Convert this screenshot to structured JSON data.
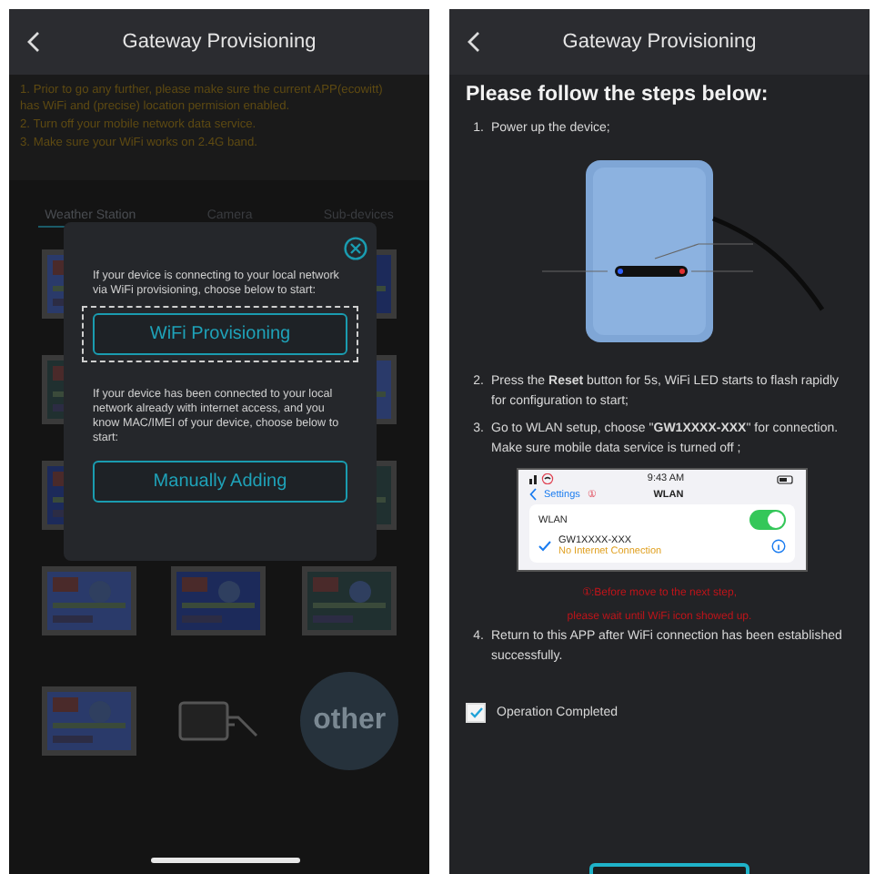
{
  "left": {
    "header": {
      "title": "Gateway Provisioning"
    },
    "notices": [
      "1. Prior to go any further, please make sure the current APP(ecowitt) has WiFi and (precise) location permision enabled.",
      "2. Turn off your mobile network data service.",
      "3. Make sure your WiFi works on 2.4G band."
    ],
    "tabs": [
      {
        "label": "Weather Station",
        "selected": true
      },
      {
        "label": "Camera",
        "selected": false
      },
      {
        "label": "Sub-devices",
        "selected": false
      }
    ],
    "side_devices": [
      {
        "kind": "picture"
      },
      {
        "kind": "picture"
      },
      {
        "kind": "picture"
      },
      {
        "kind": "picture"
      },
      {
        "kind": "picture"
      },
      {
        "kind": "picture"
      }
    ],
    "devices": [
      {
        "kind": "picture"
      },
      {
        "kind": "picture"
      },
      {
        "kind": "picture"
      },
      {
        "kind": "picture"
      },
      {
        "kind": "gateway"
      },
      {
        "kind": "other",
        "label": "other"
      }
    ],
    "dialog": {
      "intro": "If your device is connecting to your local network via WiFi provisioning, choose below to start:",
      "buttons": [
        {
          "label": "WiFi Provisioning",
          "focused": true
        },
        {
          "label": "Manually Adding",
          "focused": false
        }
      ],
      "second_intro": "If your device has been connected to your local network already with internet access, and you know MAC/IMEI of your device, choose below to start:"
    }
  },
  "right": {
    "header": {
      "title": "Gateway Provisioning"
    },
    "heading": "Please follow the steps below:",
    "steps": [
      {
        "number": "1.",
        "text": "Power up the device;",
        "kind": "device"
      },
      {
        "number": "2.",
        "text": "Press the **Reset** button for 5s, WiFi LED starts to flash rapidly for configuration to start;",
        "kind": "text"
      },
      {
        "number": "3.",
        "text": "Go to WLAN setup, choose \"**GW1XXXX-XXX**\" for connection. Make sure mobile data service is turned off ;",
        "kind": "wlan"
      },
      {
        "number": "4.",
        "text": "Return to this APP after WiFi connection has been established successfully.",
        "kind": "text"
      }
    ],
    "wlan_screen": {
      "time": "9:43 AM",
      "back": "Settings",
      "title": "WLAN",
      "marker": "①",
      "wlan_label": "WLAN",
      "wlan_on": true,
      "network": "GW1XXXX-XXX",
      "network_status": "No Internet Connection",
      "connected": true
    },
    "warnings": [
      "①:Before move to the next step,",
      "please wait until WiFi icon showed up."
    ],
    "completed": {
      "label": "Operation Completed",
      "checked": true
    }
  }
}
